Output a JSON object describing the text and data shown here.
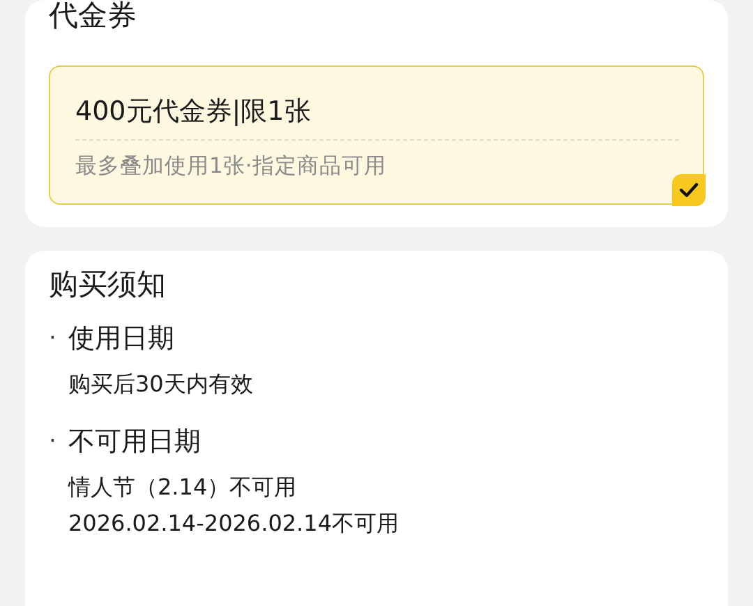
{
  "voucher_section": {
    "title": "代金券",
    "coupons": [
      {
        "name": "400元代金券|限1张",
        "note": "最多叠加使用1张·指定商品可用",
        "selected": true
      }
    ]
  },
  "notice_section": {
    "title": "购买须知",
    "items": [
      {
        "bullet": "·",
        "heading": "使用日期",
        "lines": [
          "购买后30天内有效"
        ]
      },
      {
        "bullet": "·",
        "heading": "不可用日期",
        "lines": [
          "情人节（2.14）不可用",
          "2026.02.14-2026.02.14不可用"
        ]
      }
    ]
  }
}
